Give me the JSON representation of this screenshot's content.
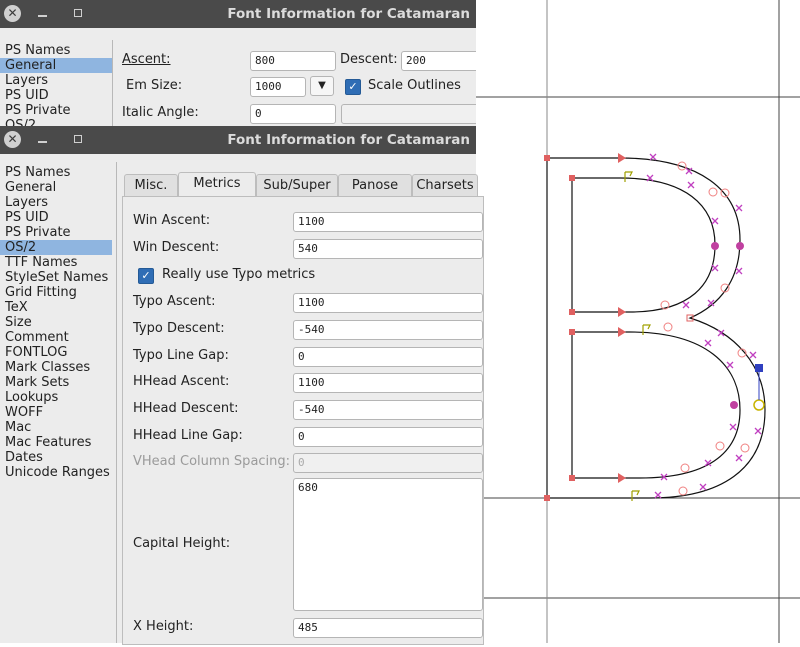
{
  "back_window": {
    "title": "Font Information for Catamaran",
    "sidebar": [
      "PS Names",
      "General",
      "Layers",
      "PS UID",
      "PS Private",
      "OS/2"
    ],
    "selected": "General",
    "ascent_label": "Ascent:",
    "ascent_value": "800",
    "descent_label": "Descent:",
    "descent_value": "200",
    "em_size_label": "Em Size:",
    "em_size_value": "1000",
    "scale_outlines_label": "Scale Outlines",
    "italic_angle_label": "Italic Angle:",
    "italic_angle_value": "0"
  },
  "front_window": {
    "title": "Font Information for Catamaran",
    "sidebar": [
      "PS Names",
      "General",
      "Layers",
      "PS UID",
      "PS Private",
      "OS/2",
      "TTF Names",
      "StyleSet Names",
      "Grid Fitting",
      "TeX",
      "Size",
      "Comment",
      "FONTLOG",
      "Mark Classes",
      "Mark Sets",
      "Lookups",
      "WOFF",
      "Mac",
      "Mac Features",
      "Dates",
      "Unicode Ranges"
    ],
    "selected": "OS/2",
    "tabs": [
      "Misc.",
      "Metrics",
      "Sub/Super",
      "Panose",
      "Charsets"
    ],
    "active_tab": "Metrics",
    "fields": {
      "win_ascent": {
        "label": "Win Ascent:",
        "value": "1100"
      },
      "win_descent": {
        "label": "Win Descent:",
        "value": "540"
      },
      "really_use_typo": {
        "label": "Really use Typo metrics",
        "checked": true
      },
      "typo_ascent": {
        "label": "Typo Ascent:",
        "value": "1100"
      },
      "typo_descent": {
        "label": "Typo Descent:",
        "value": "-540"
      },
      "typo_line_gap": {
        "label": "Typo Line Gap:",
        "value": "0"
      },
      "hhead_ascent": {
        "label": "HHead Ascent:",
        "value": "1100"
      },
      "hhead_descent": {
        "label": "HHead Descent:",
        "value": "-540"
      },
      "hhead_line_gap": {
        "label": "HHead Line Gap:",
        "value": "0"
      },
      "vhead_column_spacing": {
        "label": "VHead Column Spacing:",
        "value": "0"
      },
      "capital_height": {
        "label": "Capital Height:",
        "value": "680"
      },
      "x_height": {
        "label": "X Height:",
        "value": "485"
      }
    }
  },
  "glyph_canvas": {
    "glyph": "B"
  },
  "colors": {
    "titlebar": "#4a4a4a",
    "selection": "#8fb5e0",
    "checkbox": "#2f6db5",
    "point_red": "#e06060",
    "point_magenta": "#c040c0",
    "point_pink": "#f08080",
    "point_yellow": "#c8b400",
    "point_blue": "#3040c0"
  }
}
